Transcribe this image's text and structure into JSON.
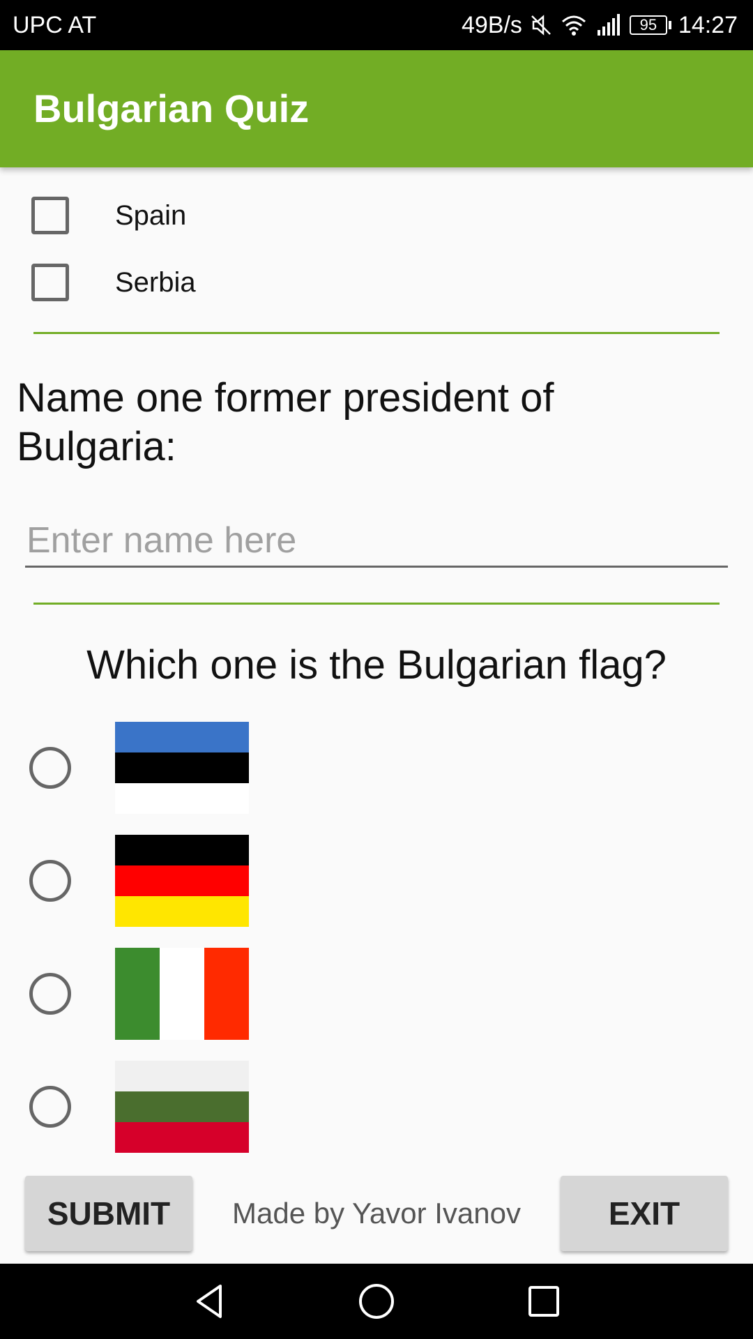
{
  "status_bar": {
    "carrier": "UPC AT",
    "data_rate": "49B/s",
    "battery": "95",
    "time": "14:27",
    "icons": [
      "mute-icon",
      "wifi-icon",
      "signal-icon",
      "battery-icon"
    ]
  },
  "app_bar": {
    "title": "Bulgarian Quiz"
  },
  "checkbox_options": [
    {
      "label": "Spain",
      "checked": false
    },
    {
      "label": "Serbia",
      "checked": false
    }
  ],
  "question_president": {
    "text": "Name one former president of Bulgaria:",
    "input_placeholder": "Enter name here",
    "input_value": ""
  },
  "question_flag": {
    "text": "Which one is the Bulgarian flag?",
    "options": [
      {
        "flag": "estonia-flag",
        "selected": false,
        "colors": [
          "#3a74c8",
          "#000000",
          "#ffffff"
        ]
      },
      {
        "flag": "germany-flag",
        "selected": false,
        "colors": [
          "#000000",
          "#ff0000",
          "#ffe600"
        ]
      },
      {
        "flag": "italy-flag",
        "selected": false,
        "colors": [
          "#3c8c2e",
          "#ffffff",
          "#ff2a00"
        ]
      },
      {
        "flag": "bulgaria-flag",
        "selected": false,
        "colors": [
          "#f0f0f0",
          "#4a6e2e",
          "#d6002a"
        ]
      }
    ]
  },
  "footer": {
    "submit_label": "SUBMIT",
    "credit": "Made by Yavor Ivanov",
    "exit_label": "EXIT"
  },
  "colors": {
    "accent": "#72ad25",
    "status_bar": "#000000",
    "nav_bar": "#000000",
    "button_bg": "#d6d6d6"
  },
  "nav_bar": {
    "icons": [
      "back-icon",
      "home-icon",
      "recents-icon"
    ]
  }
}
